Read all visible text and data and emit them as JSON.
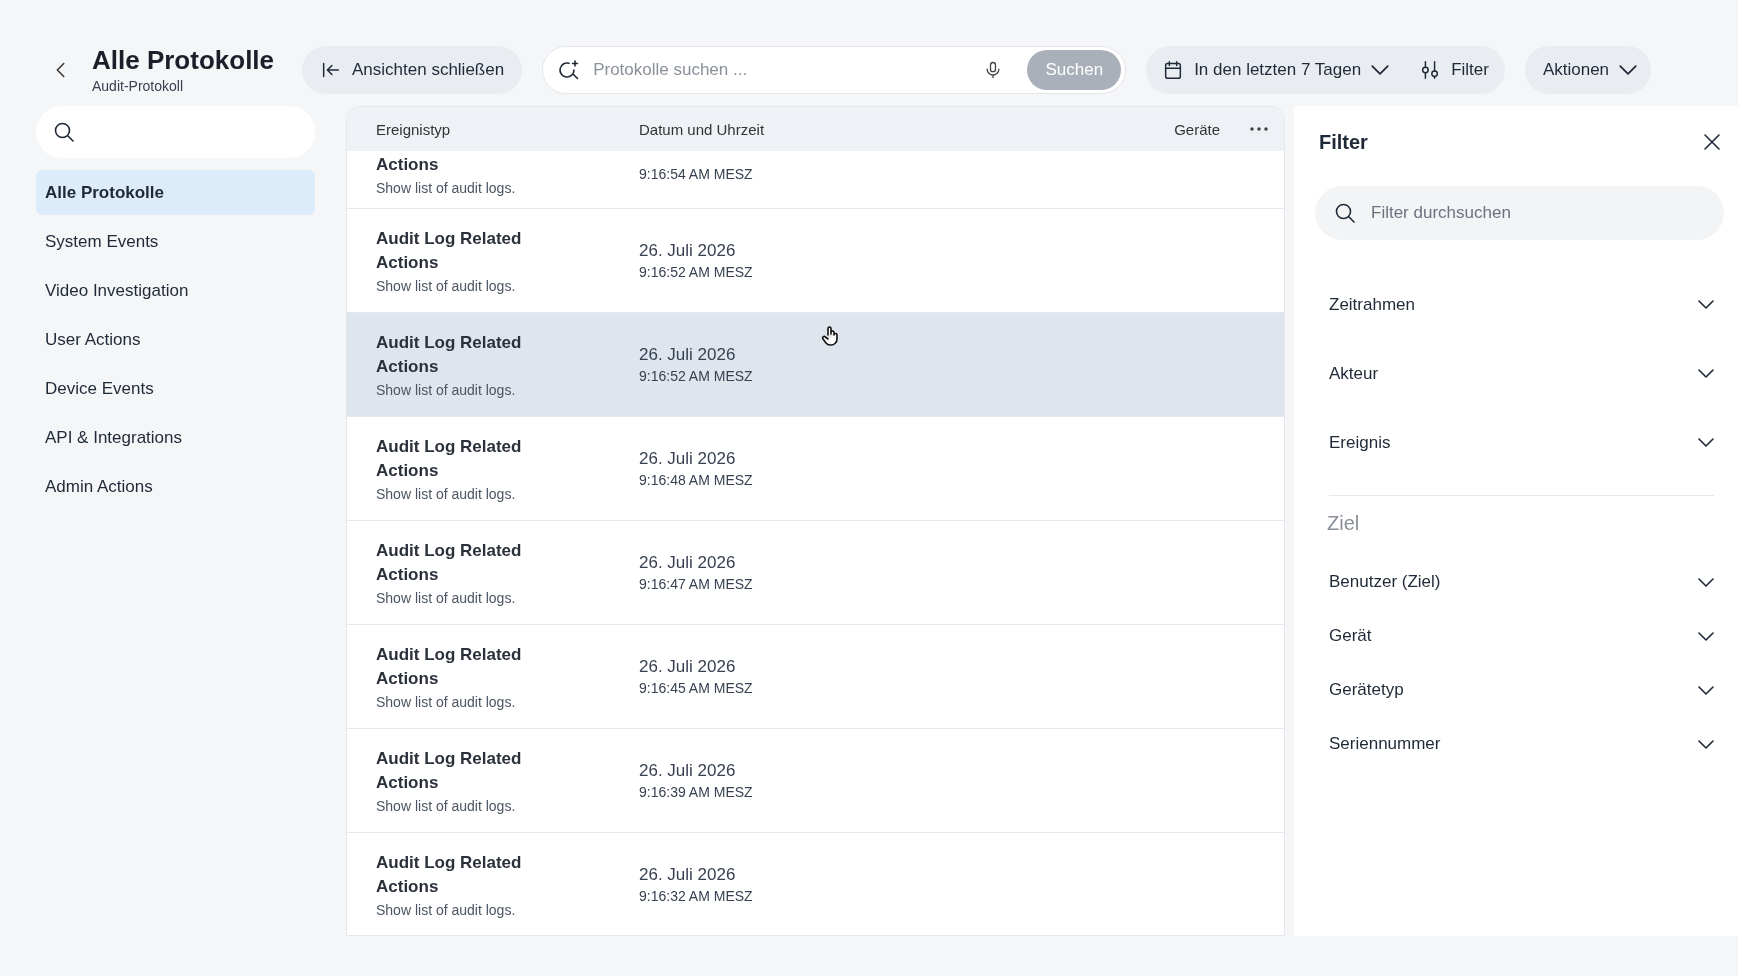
{
  "header": {
    "title": "Alle Protokolle",
    "subtitle": "Audit-Protokoll"
  },
  "toolbar": {
    "close_views": "Ansichten schließen",
    "search": {
      "placeholder": "Protokolle suchen ...",
      "button": "Suchen",
      "button_disabled": true
    },
    "date_range": "In den letzten 7 Tagen",
    "filter": "Filter",
    "actions": "Aktionen"
  },
  "sidebar": {
    "items": [
      {
        "label": "Alle Protokolle",
        "selected": true
      },
      {
        "label": "System Events",
        "selected": false
      },
      {
        "label": "Video Investigation",
        "selected": false
      },
      {
        "label": "User Actions",
        "selected": false
      },
      {
        "label": "Device Events",
        "selected": false
      },
      {
        "label": "API & Integrations",
        "selected": false
      },
      {
        "label": "Admin Actions",
        "selected": false
      }
    ]
  },
  "table": {
    "columns": [
      "Ereignistyp",
      "Datum und Uhrzeit",
      "Geräte"
    ],
    "rows": [
      {
        "title": "Actions",
        "description": "Show list of audit logs.",
        "time": "9:16:54 AM MESZ",
        "hovered": false,
        "clipped": true
      },
      {
        "title": "Audit Log Related Actions",
        "description": "Show list of audit logs.",
        "date": "26. Juli 2026",
        "time": "9:16:52 AM MESZ",
        "hovered": false
      },
      {
        "title": "Audit Log Related Actions",
        "description": "Show list of audit logs.",
        "date": "26. Juli 2026",
        "time": "9:16:52 AM MESZ",
        "hovered": true
      },
      {
        "title": "Audit Log Related Actions",
        "description": "Show list of audit logs.",
        "date": "26. Juli 2026",
        "time": "9:16:48 AM MESZ",
        "hovered": false
      },
      {
        "title": "Audit Log Related Actions",
        "description": "Show list of audit logs.",
        "date": "26. Juli 2026",
        "time": "9:16:47 AM MESZ",
        "hovered": false
      },
      {
        "title": "Audit Log Related Actions",
        "description": "Show list of audit logs.",
        "date": "26. Juli 2026",
        "time": "9:16:45 AM MESZ",
        "hovered": false
      },
      {
        "title": "Audit Log Related Actions",
        "description": "Show list of audit logs.",
        "date": "26. Juli 2026",
        "time": "9:16:39 AM MESZ",
        "hovered": false
      },
      {
        "title": "Audit Log Related Actions",
        "description": "Show list of audit logs.",
        "date": "26. Juli 2026",
        "time": "9:16:32 AM MESZ",
        "hovered": false
      }
    ]
  },
  "filter_panel": {
    "title": "Filter",
    "search": {
      "placeholder": "Filter durchsuchen"
    },
    "groups": [
      {
        "label": "Zeitrahmen",
        "expanded": false
      },
      {
        "label": "Akteur",
        "expanded": false
      },
      {
        "label": "Ereignis",
        "expanded": false
      }
    ],
    "section": "Ziel",
    "target_groups": [
      {
        "label": "Benutzer (Ziel)",
        "expanded": false
      },
      {
        "label": "Gerät",
        "expanded": false
      },
      {
        "label": "Gerätetyp",
        "expanded": false
      },
      {
        "label": "Seriennummer",
        "expanded": false
      }
    ]
  }
}
